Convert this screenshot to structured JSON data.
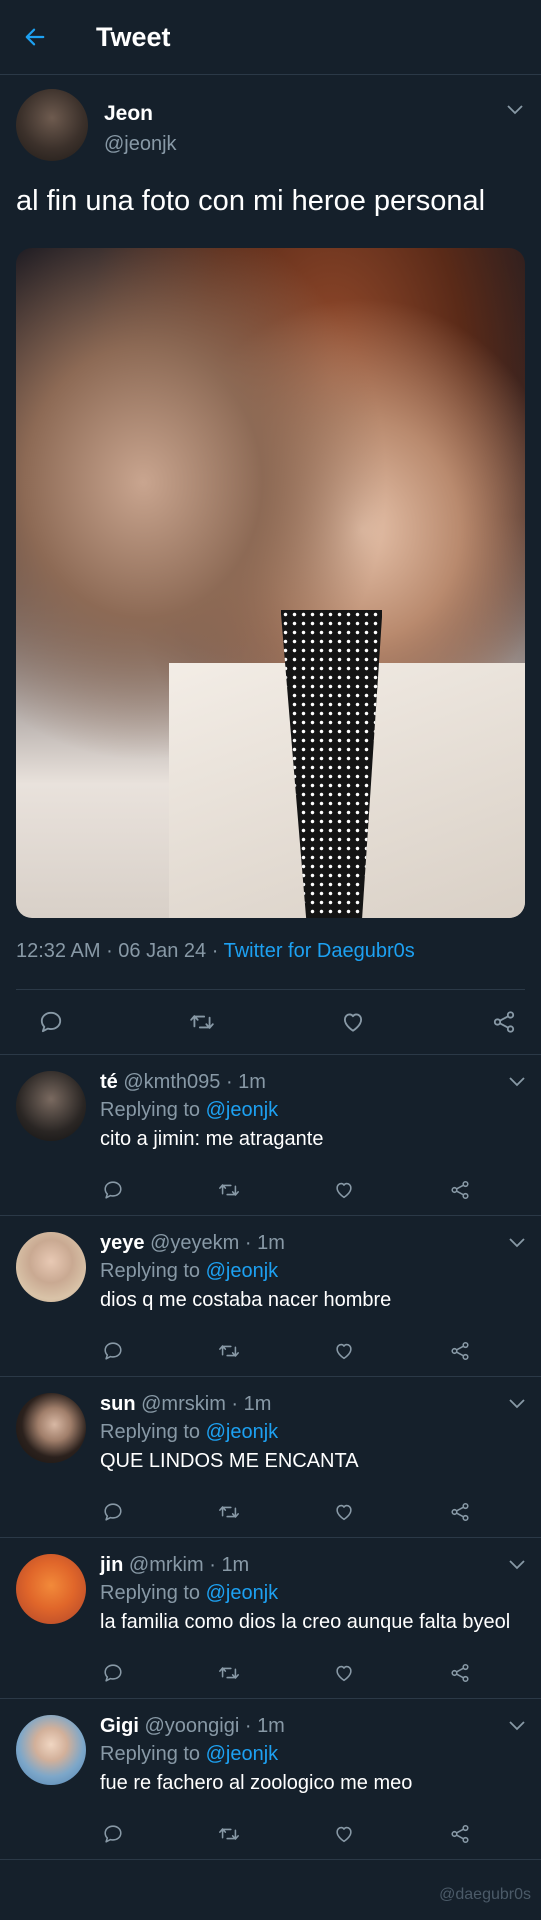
{
  "header": {
    "title": "Tweet",
    "back_icon": "back-arrow-icon"
  },
  "tweet": {
    "author_name": "Jeon",
    "author_handle": "@jeonjk",
    "text": "al fin una foto con mi heroe personal",
    "time": "12:32 AM",
    "date": "06 Jan 24",
    "source": "Twitter for Daegubr0s"
  },
  "replies": [
    {
      "name": "té",
      "handle": "@kmth095",
      "time": "1m",
      "replying_label": "Replying to",
      "replying_to": "@jeonjk",
      "text": "cito a jimin: me atragante"
    },
    {
      "name": "yeye",
      "handle": "@yeyekm",
      "time": "1m",
      "replying_label": "Replying to",
      "replying_to": "@jeonjk",
      "text": "dios q me costaba nacer hombre"
    },
    {
      "name": "sun",
      "handle": "@mrskim",
      "time": "1m",
      "replying_label": "Replying to",
      "replying_to": "@jeonjk",
      "text": "QUE LINDOS ME ENCANTA"
    },
    {
      "name": "jin",
      "handle": "@mrkim",
      "time": "1m",
      "replying_label": "Replying to",
      "replying_to": "@jeonjk",
      "text": "la familia como dios la creo aunque falta byeol"
    },
    {
      "name": "Gigi",
      "handle": "@yoongigi",
      "time": "1m",
      "replying_label": "Replying to",
      "replying_to": "@jeonjk",
      "text": "fue re fachero al zoologico me meo"
    }
  ],
  "watermark": "@daegubr0s",
  "colors": {
    "background": "#15202b",
    "accent": "#1da1f2",
    "muted": "#8899a6",
    "divider": "#2b3947"
  }
}
